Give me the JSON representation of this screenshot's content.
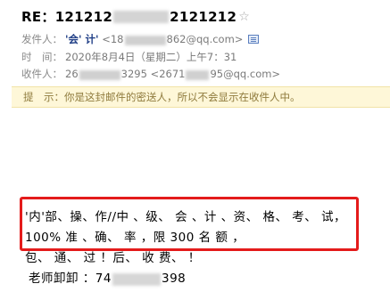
{
  "email": {
    "subject_prefix": "RE：121212",
    "subject_suffix": "2121212",
    "star_glyph": "☆",
    "from": {
      "label": "发件人：",
      "name": "'会' 计'",
      "address_prefix": "<18",
      "address_suffix": "862@qq.com>"
    },
    "time": {
      "label": "时　间：",
      "value": "2020年8月4日（星期二）上午7：31"
    },
    "to": {
      "label": "收件人：",
      "name_prefix": "26",
      "name_suffix": "3295",
      "address_prefix": "<2671",
      "address_suffix": "95@qq.com>"
    },
    "notice": "提　示：你是这封邮件的密送人，所以不会显示在收件人中。",
    "body": {
      "line1": "'内'部、操、作//中 、级、 会 、计 、资、 格、  考、   试，",
      "line2": "100% 准 、确、 率 ，限 300 名 额 ，",
      "line3": "包、 通、 过 ！后、 收 费、  ！",
      "contact_prefix": "老师卸卸 ：74",
      "contact_suffix": "398"
    }
  },
  "colors": {
    "highlight_border": "#e41b1b",
    "notice_background": "#fef7d8",
    "sender_name": "#1f3e86"
  },
  "icons": {
    "star": "star-icon",
    "contact_card": "contact-card-icon"
  }
}
